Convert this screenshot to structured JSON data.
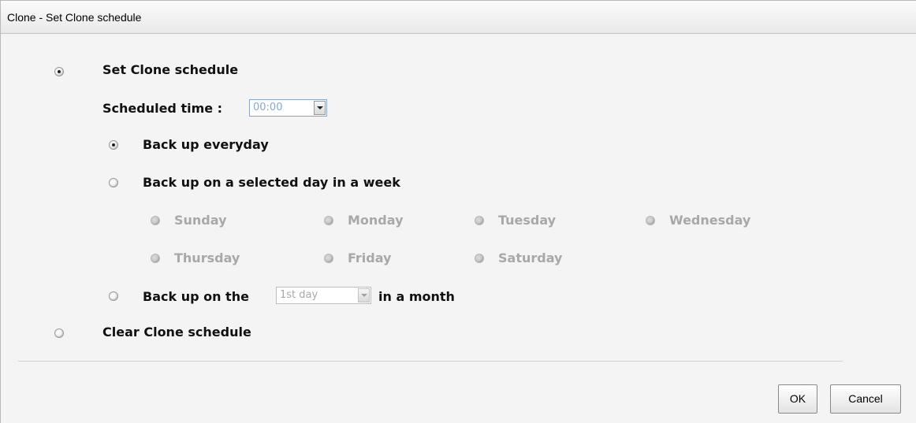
{
  "dialog": {
    "title": "Clone - Set Clone schedule"
  },
  "set_schedule": {
    "label": "Set Clone schedule",
    "selected": true
  },
  "scheduled_time": {
    "label": "Scheduled time :",
    "value": "00:00"
  },
  "options": {
    "everyday": {
      "label": "Back up everyday",
      "selected": true
    },
    "weekly": {
      "label": "Back up on a selected day in a week",
      "selected": false
    },
    "monthly": {
      "label_prefix": "Back up on the",
      "day_value": "1st day",
      "label_suffix": "in a month",
      "selected": false
    }
  },
  "weekdays": [
    "Sunday",
    "Monday",
    "Tuesday",
    "Wednesday",
    "Thursday",
    "Friday",
    "Saturday"
  ],
  "clear_schedule": {
    "label": "Clear Clone schedule",
    "selected": false
  },
  "buttons": {
    "ok": "OK",
    "cancel": "Cancel"
  }
}
